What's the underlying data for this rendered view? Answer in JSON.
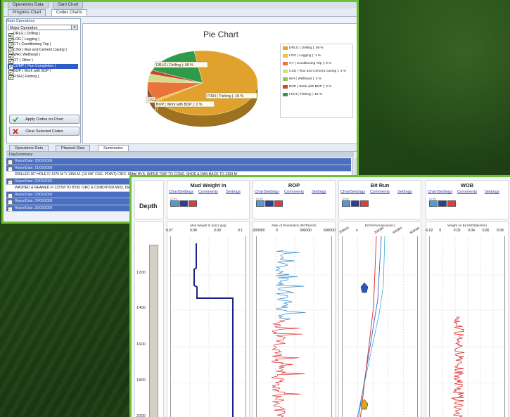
{
  "window1": {
    "top_tabs": [
      "Operations Data",
      "Gant Chart"
    ],
    "sub_tabs": [
      "Progress Chart",
      "Codes Charts"
    ],
    "left": {
      "main_operations_label": "Main Operations",
      "select_value": "Major Operation",
      "codes": [
        {
          "label": "DRLG ( Drilling )",
          "selected": false
        },
        {
          "label": "LOG ( Logging )",
          "selected": false
        },
        {
          "label": "CT ( Conditioning Trip )",
          "selected": false
        },
        {
          "label": "CSG ( Run and Cement Casing )",
          "selected": false
        },
        {
          "label": "WH ( Wellhead )",
          "selected": false
        },
        {
          "label": "OT ( Other )",
          "selected": false
        },
        {
          "label": "COMP ( Run Completion )",
          "selected": true
        },
        {
          "label": "BOP ( Work with BOP )",
          "selected": false
        },
        {
          "label": "FISH ( Fishing )",
          "selected": false
        }
      ],
      "apply_button": "Apply Codes on Chart",
      "clear_button": "Clear Selected Codes"
    },
    "chart_data": {
      "type": "pie",
      "title": "Pie Chart",
      "slices": [
        {
          "label": "DRLG ( Drilling ): 68 %",
          "value": 68,
          "color": "#e0a22c"
        },
        {
          "label": "LOG ( Logging ): 1 %",
          "value": 1,
          "color": "#f0c040"
        },
        {
          "label": "CT ( Conditioning Trip ): 9 %",
          "value": 9,
          "color": "#e9743a"
        },
        {
          "label": "CSG ( Run and Cement Casing ): 4 %",
          "value": 4,
          "color": "#d3dc8a"
        },
        {
          "label": "WH ( Wellhead ): 0 %",
          "value": 0,
          "color": "#9bc04c"
        },
        {
          "label": "BOP ( Work with BOP ): 2 %",
          "value": 2,
          "color": "#c84a32"
        },
        {
          "label": "FISH ( Fishing ): 16 %",
          "value": 16,
          "color": "#2e9a4a"
        }
      ],
      "callouts": [
        "DRLG ( Drilling ): 68 %",
        "FISH ( Fishing ): 16 %",
        "CSG",
        "BOP ( Work with BOP ): 2 %"
      ]
    },
    "bottom_tabs": [
      "Operations Data",
      "Planned Data",
      "Summaries"
    ],
    "summary_header": "DaySummary",
    "rows": [
      {
        "type": "rep",
        "text": "ReportDate: 20/09/2006"
      },
      {
        "type": "rep",
        "text": "ReportDate: 21/09/2006"
      },
      {
        "type": "desc",
        "text": "DRILLED 36\" HOLE F/ 1275 M T/ 1356 M. (13 5/8\" CSG. POINT) CIRC. 85bbl HVS. WIPER TRIP TO COND. SHOE & RAN BACK TO 1333 M"
      },
      {
        "type": "rep",
        "text": "ReportDate: 22/09/2006"
      },
      {
        "type": "desc",
        "text": "WASHED & REAMED F/ 1337M TO BTM, CIRC & CONDITION MUD, DROPPED"
      },
      {
        "type": "rep",
        "text": "ReportDate: 23/09/2006"
      },
      {
        "type": "rep",
        "text": "ReportDate: 24/09/2006"
      },
      {
        "type": "rep",
        "text": "ReportDate: 25/09/2006"
      }
    ]
  },
  "window2": {
    "depth_label": "Depth",
    "depth_ticks": [
      "1200",
      "1400",
      "1600",
      "1800",
      "2000"
    ],
    "tracks": [
      {
        "title": "Mud Weight In",
        "links": [
          "ChartSettings",
          "Comments",
          "Settings"
        ],
        "line_label": "Lines",
        "axis_title": "Mud Weight In (In)(1 ppg)",
        "ticks": [
          "0.07",
          "0.08",
          "0.09",
          "0.1"
        ]
      },
      {
        "title": "ROP",
        "links": [
          "ChartSettings",
          "Comments",
          "Settings"
        ],
        "line_label": "Lines",
        "axis_title": "Rate of Penetration (ROP)(m/h)",
        "ticks": [
          "-300000",
          "0",
          "300000",
          "600000"
        ]
      },
      {
        "title": "Bit Run",
        "links": [
          "ChartSettings",
          "Comments",
          "Settings"
        ],
        "line_label": "Lines",
        "axis_title": "Bit Performance(sec)",
        "ticks": [
          "-200000",
          "0",
          "200000",
          "400000",
          "600000"
        ]
      },
      {
        "title": "WOB",
        "links": [
          "ChartSettings",
          "Comments",
          "Settings"
        ],
        "line_label": "Lines",
        "axis_title": "Weight on Bit (WOB)(k-lbm)",
        "ticks": [
          "-0.02",
          "0",
          "0.02",
          "0.04",
          "0.06",
          "0.08"
        ]
      }
    ],
    "swatch_colors": [
      "#4a9be0",
      "#2a3e9a",
      "#e03a3a"
    ]
  }
}
